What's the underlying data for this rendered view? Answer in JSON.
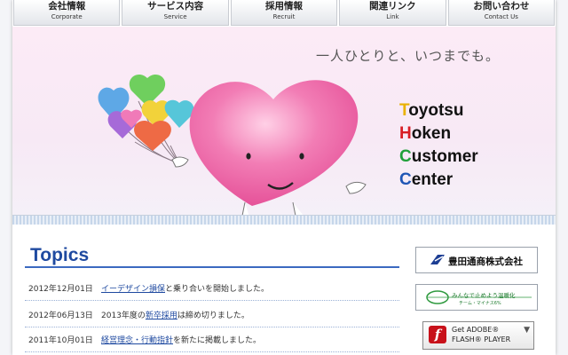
{
  "nav": [
    {
      "jp": "会社情報",
      "en": "Corporate"
    },
    {
      "jp": "サービス内容",
      "en": "Service"
    },
    {
      "jp": "採用情報",
      "en": "Recruit"
    },
    {
      "jp": "関連リンク",
      "en": "Link"
    },
    {
      "jp": "お問い合わせ",
      "en": "Contact Us"
    }
  ],
  "hero": {
    "tagline": "一人ひとりと、いつまでも。",
    "brand": [
      {
        "initial": "T",
        "rest": "oyotsu",
        "color": "#e9b100"
      },
      {
        "initial": "H",
        "rest": "oken",
        "color": "#d81d24"
      },
      {
        "initial": "C",
        "rest": "ustomer",
        "color": "#20a03a"
      },
      {
        "initial": "C",
        "rest": "enter",
        "color": "#1e56b5"
      }
    ]
  },
  "topics": {
    "title": "Topics",
    "items": [
      {
        "date": "2012年12月01日",
        "link": "イーデザイン損保",
        "pre": "",
        "post": "と乗り合いを開始しました。"
      },
      {
        "date": "2012年06月13日",
        "link": "新卒採用",
        "pre": "2013年度の",
        "post": "は締め切りました。"
      },
      {
        "date": "2011年10月01日",
        "link": "経営理念・行動指針",
        "pre": "",
        "post": "を新たに掲載しました。"
      }
    ]
  },
  "banners": {
    "toyota_tsusho": "豊田通商株式会社",
    "team_minus": {
      "title": "みんなで止めよう温暖化",
      "sub": "チーム・マイナス6%"
    },
    "flash": {
      "line1": "Get ADOBE®",
      "line2": "FLASH® PLAYER"
    }
  },
  "colors": {
    "accent_blue": "#1f4aa0",
    "heart_pink": "#ee5fa1"
  }
}
